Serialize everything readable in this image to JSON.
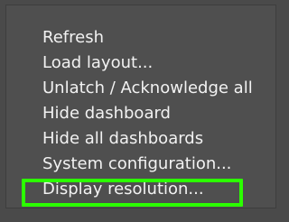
{
  "menu": {
    "items": [
      {
        "label": "Refresh"
      },
      {
        "label": "Load layout..."
      },
      {
        "label": "Unlatch / Acknowledge all"
      },
      {
        "label": "Hide dashboard"
      },
      {
        "label": "Hide all dashboards"
      },
      {
        "label": "System configuration..."
      },
      {
        "label": "Display resolution..."
      }
    ],
    "selected_index": 6
  },
  "colors": {
    "background": "#4a4a4a",
    "menu_bg": "#4f4f4f",
    "text": "#f2f2f2",
    "highlight": "#2bff00",
    "spinner": "#28e000"
  },
  "icons": {
    "loading": "loading-spinner-icon"
  }
}
